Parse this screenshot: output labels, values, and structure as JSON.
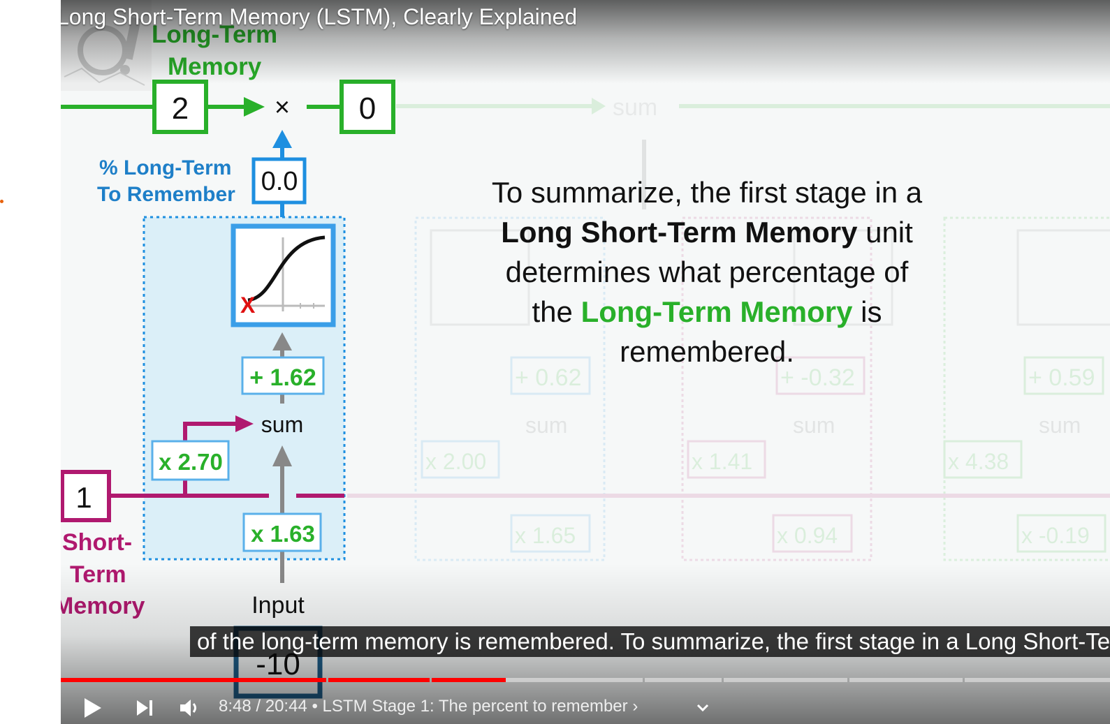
{
  "video": {
    "title": "Long Short-Term Memory (LSTM), Clearly Explained"
  },
  "diagram": {
    "ltm_label_line1": "Long-Term",
    "ltm_label_line2": "Memory",
    "ltm_value": "2",
    "multiply_symbol": "×",
    "ltm_result": "0",
    "pct_label_line1": "% Long-Term",
    "pct_label_line2": "To Remember",
    "pct_value": "0.0",
    "bias": "+ 1.62",
    "sum_label": "sum",
    "stm_weight": "x 2.70",
    "stm_value": "1",
    "stm_label_line1": "Short-",
    "stm_label_line2": "Term",
    "stm_label_line3": "Memory",
    "input_weight": "x 1.63",
    "input_label": "Input",
    "input_value": "-10",
    "ghost_sum_top": "sum",
    "ghost_biases": [
      "+ 0.62",
      "+ -0.32",
      "+ 0.59"
    ],
    "ghost_sums": [
      "sum",
      "sum",
      "sum"
    ],
    "ghost_stm_weights": [
      "x 2.00",
      "x 1.41",
      "x 4.38"
    ],
    "ghost_input_weights": [
      "x 1.65",
      "x 0.94",
      "x -0.19"
    ]
  },
  "summary": {
    "part1": "To summarize, the first stage in a",
    "bold": "Long Short-Term Memory",
    "part2": " unit",
    "part3": "determines what percentage of",
    "part4": "the ",
    "green": "Long-Term Memory",
    "part5": " is",
    "part6": "remembered."
  },
  "caption": {
    "text": "of the long-term memory is remembered. To summarize, the first stage in a Long Short-Term Memory"
  },
  "player": {
    "time_current": "8:48",
    "time_total": "20:44",
    "time_separator": " / ",
    "chapter_separator": " • ",
    "chapter_title": "LSTM Stage 1: The percent to remember",
    "chapter_chevron": "›",
    "progress_fraction": 0.424,
    "icons": {
      "play": "play-icon",
      "next": "next-icon",
      "volume": "volume-icon",
      "chevron": "chevron-down-icon"
    }
  },
  "colors": {
    "green": "#29b02a",
    "blue": "#1e8fe0",
    "magenta": "#b0196f",
    "progress_red": "#ff0000"
  }
}
